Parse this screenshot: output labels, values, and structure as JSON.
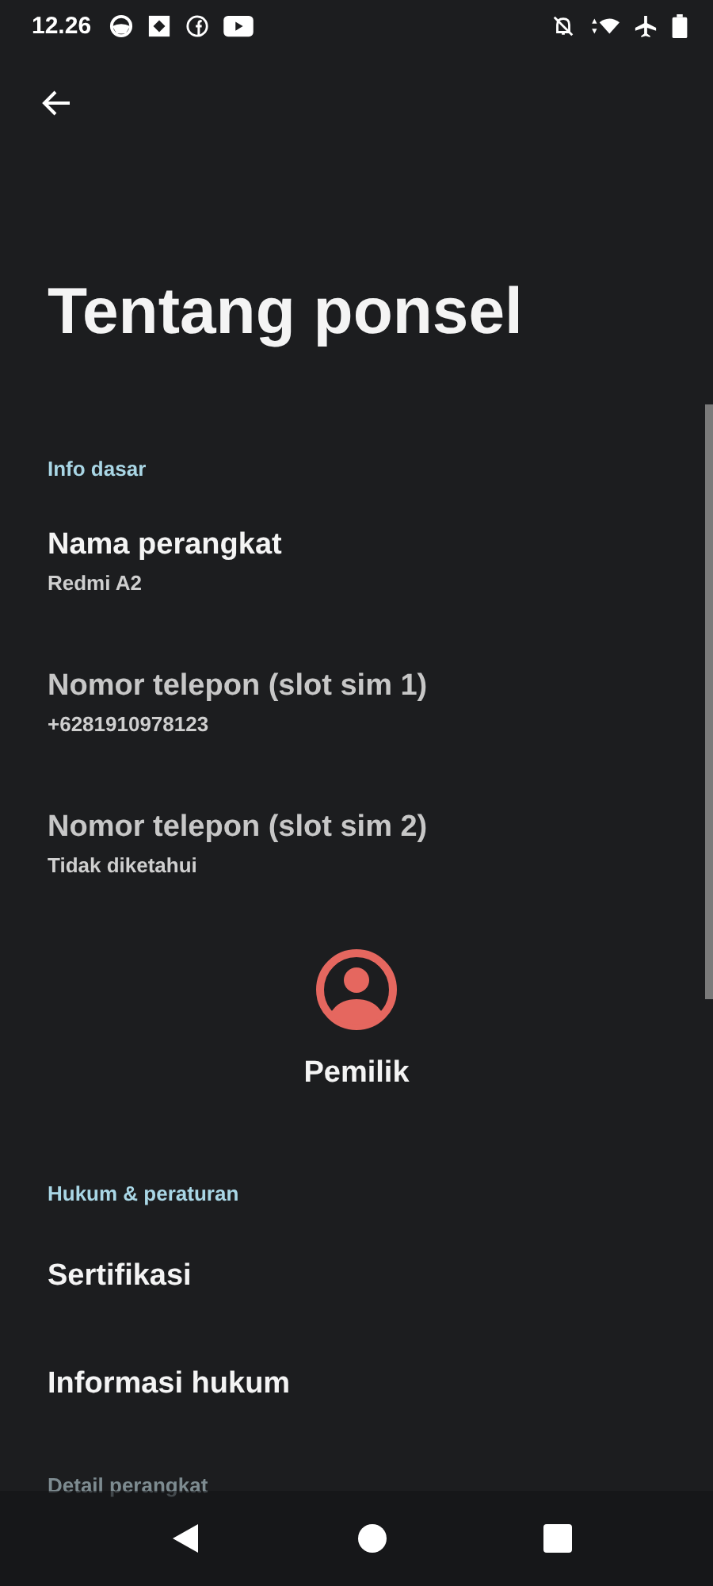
{
  "status_bar": {
    "time": "12.26"
  },
  "title": "Tentang ponsel",
  "sections": [
    {
      "header": "Info dasar",
      "items": [
        {
          "kind": "pref",
          "title": "Nama perangkat",
          "summary": "Redmi A2",
          "disabled": false
        },
        {
          "kind": "pref",
          "title": "Nomor telepon (slot sim 1)",
          "summary": "+6281910978123",
          "disabled": true
        },
        {
          "kind": "pref",
          "title": "Nomor telepon (slot sim 2)",
          "summary": "Tidak diketahui",
          "disabled": true
        },
        {
          "kind": "owner",
          "title": "Pemilik"
        }
      ]
    },
    {
      "header": "Hukum & peraturan",
      "items": [
        {
          "kind": "pref",
          "title": "Sertifikasi",
          "disabled": false
        },
        {
          "kind": "pref",
          "title": "Informasi hukum",
          "disabled": false
        }
      ]
    },
    {
      "header": "Detail perangkat"
    }
  ]
}
